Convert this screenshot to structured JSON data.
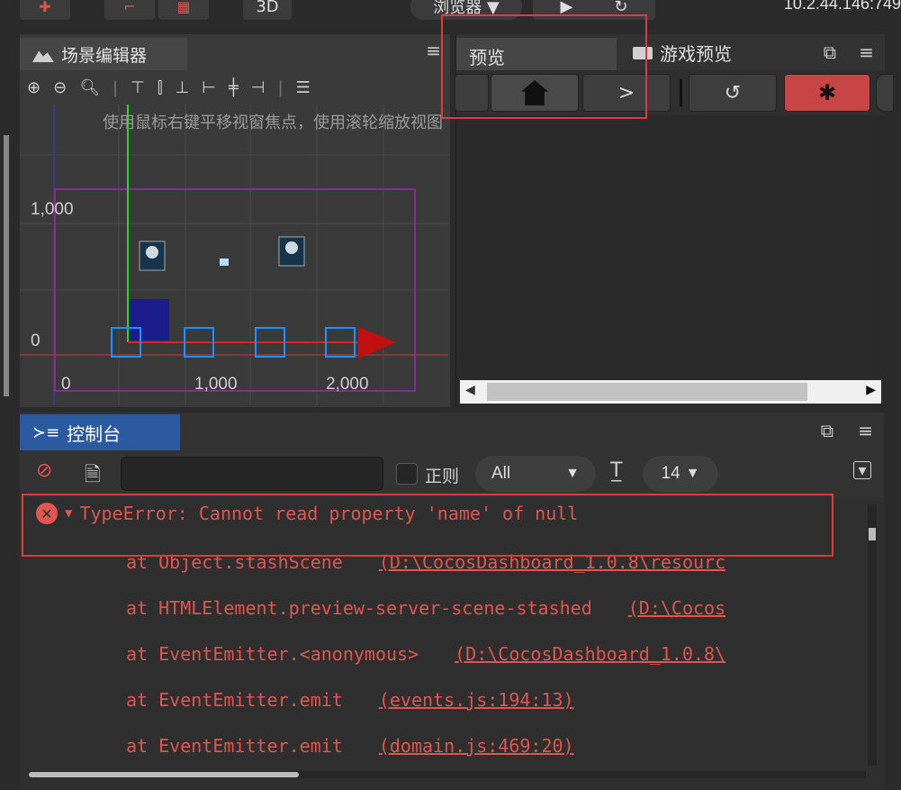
{
  "topbar": {
    "label_3d": "3D",
    "browser_label": "浏览器 ▼",
    "ip": "10.2.44.146:749"
  },
  "scene": {
    "tab_label": "场景编辑器",
    "hint": "使用鼠标右键平移视窗焦点，使用滚轮缩放视图",
    "axis_y": [
      "1,000",
      "0"
    ],
    "axis_x": [
      "0",
      "1,000",
      "2,000"
    ]
  },
  "preview": {
    "tab_preview": "预览",
    "tab_game_preview": "游戏预览"
  },
  "console": {
    "tab_label": "控制台",
    "filter_value": "",
    "regex_label": "正则",
    "level_value": "All",
    "fontsize_value": "14",
    "error": "TypeError: Cannot read property 'name' of null",
    "stack": [
      {
        "text": "at Object.stashScene",
        "loc": "(D:\\CocosDashboard_1.0.8\\resourc"
      },
      {
        "text": "at HTMLElement.preview-server-scene-stashed",
        "loc": "(D:\\Cocos"
      },
      {
        "text": "at EventEmitter.<anonymous>",
        "loc": "(D:\\CocosDashboard_1.0.8\\"
      },
      {
        "text": "at EventEmitter.emit",
        "loc": "(events.js:194:13)"
      },
      {
        "text": "at EventEmitter.emit",
        "loc": "(domain.js:469:20)"
      }
    ]
  }
}
